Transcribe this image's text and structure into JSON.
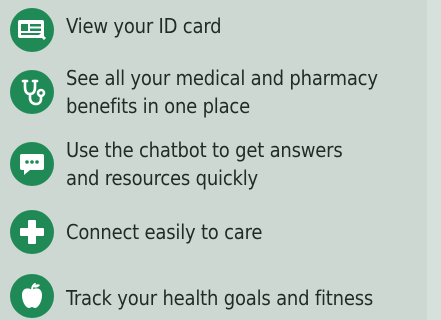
{
  "items": [
    {
      "label": "View your ID card",
      "icon": "id-card-icon"
    },
    {
      "label": "See all your medical and pharmacy\nbenefits in one place",
      "icon": "stethoscope-icon"
    },
    {
      "label": "Use the chatbot to get answers\nand resources quickly",
      "icon": "chat-bubble-icon"
    },
    {
      "label": "Connect easily to care",
      "icon": "plus-cross-icon"
    },
    {
      "label": "Track your health goals and fitness",
      "icon": "apple-icon"
    }
  ],
  "colors": {
    "background": "#ccd8d1",
    "icon_circle": "#1f8a56",
    "text": "#1f2b24"
  }
}
